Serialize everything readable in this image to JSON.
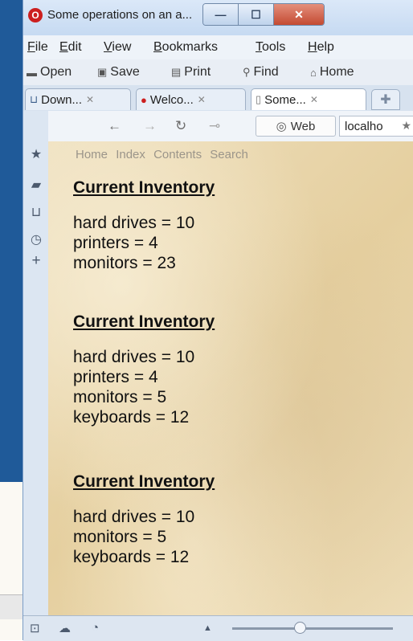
{
  "window": {
    "title": "Some operations on an a...",
    "buttons": {
      "minimize": "—",
      "maximize": "☐",
      "close": "✕"
    }
  },
  "menubar": {
    "items": [
      "File",
      "Edit",
      "View",
      "Bookmarks",
      "Tools",
      "Help"
    ]
  },
  "toolbar": {
    "items": [
      {
        "label": "Open",
        "icon": "folder-icon"
      },
      {
        "label": "Save",
        "icon": "save-icon"
      },
      {
        "label": "Print",
        "icon": "print-icon"
      },
      {
        "label": "Find",
        "icon": "search-icon"
      },
      {
        "label": "Home",
        "icon": "home-icon"
      }
    ]
  },
  "tabs": [
    {
      "label": "Down...",
      "icon": "downloads-icon",
      "active": false
    },
    {
      "label": "Welco...",
      "icon": "opera-icon",
      "active": false
    },
    {
      "label": "Some...",
      "icon": "page-icon",
      "active": true
    }
  ],
  "navbar": {
    "web_label": "Web",
    "url": "localho"
  },
  "page": {
    "nav_links": [
      "Home",
      "Index",
      "Contents",
      "Search"
    ],
    "sections": [
      {
        "heading": "Current Inventory",
        "lines": [
          "hard drives = 10",
          "printers = 4",
          "monitors = 23"
        ]
      },
      {
        "heading": "Current Inventory",
        "lines": [
          "hard drives = 10",
          "printers = 4",
          "monitors = 5",
          "keyboards = 12"
        ]
      },
      {
        "heading": "Current Inventory",
        "lines": [
          "hard drives = 10",
          "monitors = 5",
          "keyboards = 12"
        ]
      }
    ]
  },
  "colors": {
    "desktop": "#1f5a99",
    "title_bar": "#cfe0f3",
    "page_background": "#ead8b0",
    "close_button": "#c44a32"
  }
}
